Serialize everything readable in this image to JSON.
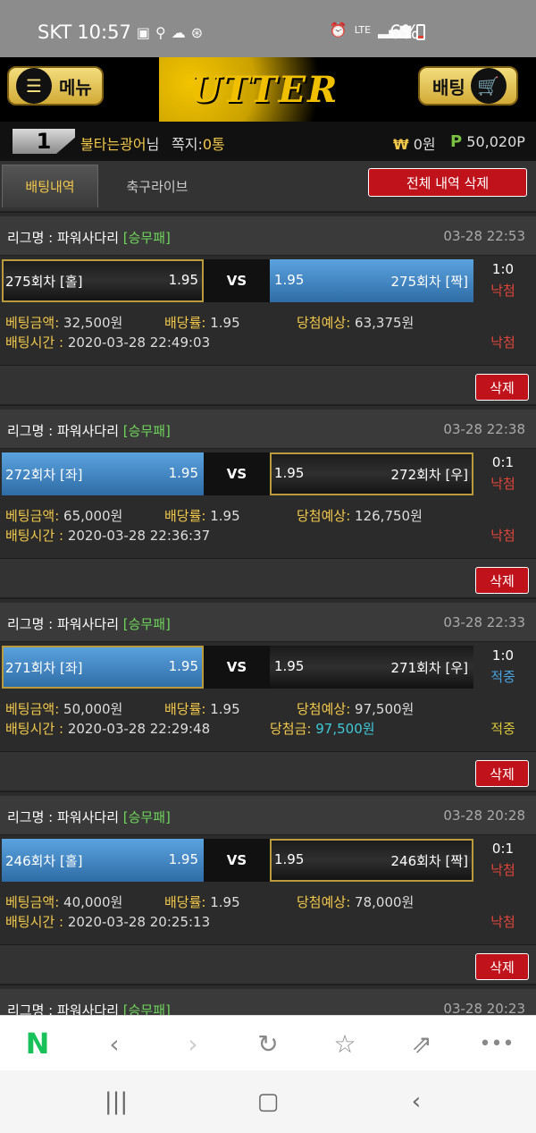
{
  "status": {
    "carrier": "SKT",
    "time": "10:57",
    "battery": "6%",
    "net": "LTE"
  },
  "header": {
    "menu_label": "메뉴",
    "logo_text": "UTTER",
    "bet_label": "배팅"
  },
  "user": {
    "rank": "1",
    "name": "불타는광어",
    "suffix": "님",
    "notes_label": "쪽지:",
    "notes_value": "0통",
    "won_symbol": "₩",
    "money": "0원",
    "point_symbol": "P",
    "points": "50,020P"
  },
  "tabs": {
    "betting_history": "배팅내역",
    "soccer_live": "축구라이브",
    "delete_all": "전체 내역 삭제"
  },
  "bets": [
    {
      "league": "리그명 : 파워사다리",
      "type": "[승무패]",
      "time": "03-28 22:53",
      "left": "275회차 [홀]",
      "left_odds": "1.95",
      "right": "275회차 [짝]",
      "right_odds": "1.95",
      "vs": "VS",
      "score": "1:0",
      "result": "낙첨",
      "amount_label": "베팅금액:",
      "amount": "32,500원",
      "rate_label": "배당률:",
      "rate": "1.95",
      "expect_label": "당첨예상:",
      "expect": "63,375원",
      "time_label": "배팅시간 :",
      "bet_time": "2020-03-28 22:49:03",
      "status": "낙첨",
      "delete": "삭제"
    },
    {
      "league": "리그명 : 파워사다리",
      "type": "[승무패]",
      "time": "03-28 22:38",
      "left": "272회차 [좌]",
      "left_odds": "1.95",
      "right": "272회차 [우]",
      "right_odds": "1.95",
      "vs": "VS",
      "score": "0:1",
      "result": "낙첨",
      "amount_label": "베팅금액:",
      "amount": "65,000원",
      "rate_label": "배당률:",
      "rate": "1.95",
      "expect_label": "당첨예상:",
      "expect": "126,750원",
      "time_label": "배팅시간 :",
      "bet_time": "2020-03-28 22:36:37",
      "status": "낙첨",
      "delete": "삭제"
    },
    {
      "league": "리그명 : 파워사다리",
      "type": "[승무패]",
      "time": "03-28 22:33",
      "left": "271회차 [좌]",
      "left_odds": "1.95",
      "right": "271회차 [우]",
      "right_odds": "1.95",
      "vs": "VS",
      "score": "1:0",
      "result": "적중",
      "amount_label": "베팅금액:",
      "amount": "50,000원",
      "rate_label": "배당률:",
      "rate": "1.95",
      "expect_label": "당첨예상:",
      "expect": "97,500원",
      "time_label": "배팅시간 :",
      "bet_time": "2020-03-28 22:29:48",
      "win_label": "당첨금:",
      "win_amount": "97,500원",
      "status": "적중",
      "delete": "삭제"
    },
    {
      "league": "리그명 : 파워사다리",
      "type": "[승무패]",
      "time": "03-28 20:28",
      "left": "246회차 [홀]",
      "left_odds": "1.95",
      "right": "246회차 [짝]",
      "right_odds": "1.95",
      "vs": "VS",
      "score": "0:1",
      "result": "낙첨",
      "amount_label": "베팅금액:",
      "amount": "40,000원",
      "rate_label": "배당률:",
      "rate": "1.95",
      "expect_label": "당첨예상:",
      "expect": "78,000원",
      "time_label": "배팅시간 :",
      "bet_time": "2020-03-28 20:25:13",
      "status": "낙첨",
      "delete": "삭제"
    },
    {
      "league": "리그명 : 파워사다리",
      "type": "[승무패]",
      "time": "03-28 20:23"
    }
  ],
  "browser": {
    "home": "N"
  }
}
